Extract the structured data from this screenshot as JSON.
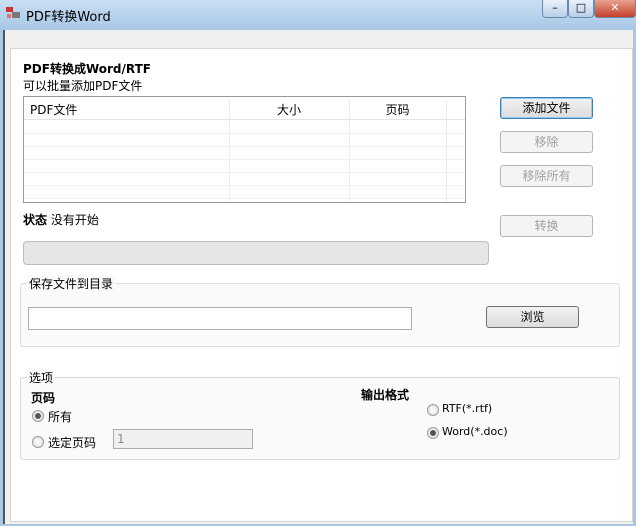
{
  "window": {
    "title": "PDF转换Word",
    "minimize": "–",
    "maximize": "□",
    "close": "✕"
  },
  "header": {
    "title": "PDF转换成Word/RTF",
    "subtitle": "可以批量添加PDF文件"
  },
  "table": {
    "columns": [
      "PDF文件",
      "大小",
      "页码"
    ],
    "rows": []
  },
  "buttons": {
    "add": "添加文件",
    "remove": "移除",
    "remove_all": "移除所有",
    "convert": "转换",
    "browse": "浏览"
  },
  "status": {
    "label": "状态",
    "value": "没有开始",
    "progress": 0
  },
  "save": {
    "legend": "保存文件到目录",
    "path": ""
  },
  "options": {
    "legend": "选项",
    "pages_label": "页码",
    "all": "所有",
    "selected": "选定页码",
    "page_value": "1",
    "format_label": "输出格式",
    "rtf": "RTF(*.rtf)",
    "word": "Word(*.doc)",
    "page_mode": "all",
    "format": "word"
  }
}
